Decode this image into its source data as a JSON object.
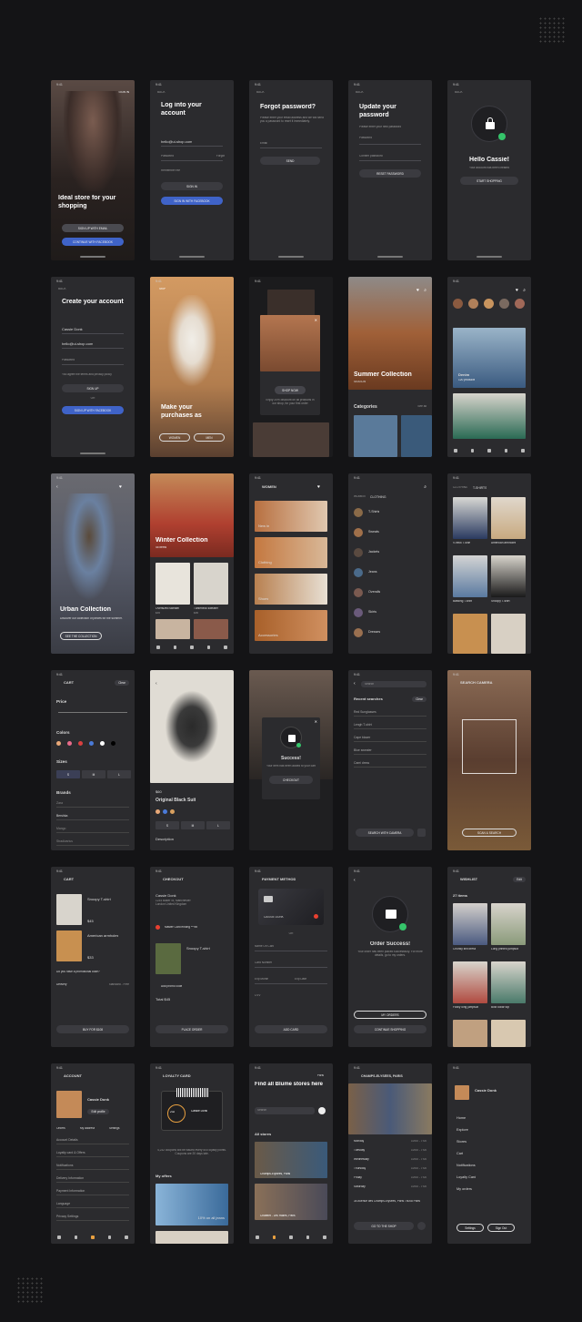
{
  "status_time": "9:41",
  "back": "BACK",
  "rows": {
    "r1": {
      "s1": {
        "signin": "SIGN IN",
        "title": "Ideal store for your shopping",
        "btn1": "SIGN UP WITH EMAIL",
        "btn2": "CONTINUE WITH FACEBOOK"
      },
      "s2": {
        "title": "Log into your account",
        "email": "hello@ui-shop.com",
        "password": "Password",
        "forgot": "Forgot",
        "remember": "Remember me",
        "btn1": "SIGN IN",
        "btn2": "SIGN IN WITH FACEBOOK"
      },
      "s3": {
        "title": "Forgot password?",
        "desc": "Please enter your email address and we will send you a password to reset it immediately.",
        "email": "Email",
        "btn": "SEND"
      },
      "s4": {
        "title": "Update your password",
        "desc": "Please enter your new password",
        "password": "Password",
        "confirm": "Confirm password",
        "btn": "RESET PASSWORD"
      },
      "s5": {
        "title": "Hello Cassie!",
        "desc": "Your account has been created",
        "btn": "START SHOPPING"
      }
    },
    "r2": {
      "s1": {
        "title": "Create your account",
        "name": "Cassie Donk",
        "email": "hello@ui-shop.com",
        "password": "Password",
        "agree": "You agree the terms and privacy policy",
        "btn1": "SIGN UP",
        "or": "OR",
        "btn2": "SIGN UP WITH FACEBOOK"
      },
      "s2": {
        "skip": "SKIP",
        "title": "Make your purchases as",
        "b1": "WOMEN",
        "b2": "MEN"
      },
      "s3": {
        "btn": "SHOP NOW",
        "desc": "Enjoy 20% discount on all products in our shop, for your first order"
      },
      "s4": {
        "title": "Summer Collection",
        "sub": "SEASON",
        "cat": "Categories",
        "see": "See all"
      },
      "s5": {
        "name": "Denim",
        "sub": "120 products"
      }
    },
    "r3": {
      "s1": {
        "title": "Urban Collection",
        "desc": "Discover our collection of pieces for the summer.",
        "btn": "SEE THE COLLECTION"
      },
      "s2": {
        "title": "Winter Collection",
        "sub": "45 items",
        "p1": "Oversized sweater",
        "p2": "Turtleneck sweater",
        "p1price": "$49",
        "p2price": "$59"
      },
      "s3": {
        "menu": "WOMEN",
        "c1": "New in",
        "c2": "Clothing",
        "c3": "Shoes",
        "c4": "Accessories"
      },
      "s4": {
        "crumb1": "WOMEN",
        "crumb2": "CLOTHING",
        "items": [
          "T-Shirts",
          "Sweats",
          "Jackets",
          "Jeans",
          "Overalls",
          "Skirts",
          "Dresses"
        ]
      },
      "s5": {
        "crumb1": "CLOTHING",
        "crumb2": "T-SHIRTS",
        "p1": "V-neck T-shirt",
        "p2": "American armholes",
        "p3": "Batwing T-shirt",
        "p4": "Snoopy T-shirt"
      }
    },
    "r4": {
      "s1": {
        "title": "CART",
        "clear": "Clear",
        "price": "Price",
        "colors": "Colors",
        "sizes": "Sizes",
        "s1": "S",
        "s2": "M",
        "s3": "L",
        "brands": "Brands",
        "b1": "Zara",
        "b2": "Bershka",
        "b3": "Mango",
        "b4": "Stradivarius"
      },
      "s2": {
        "price": "$60",
        "name": "Original Black Suit",
        "s1": "S",
        "s2": "M",
        "s3": "L",
        "desc": "Description"
      },
      "s3": {
        "title": "Success!",
        "desc": "Your item has been added to your cart",
        "btn": "CHECKOUT"
      },
      "s4": {
        "search": "Search",
        "recent": "Recent searches",
        "clear": "Clear",
        "items": [
          "Red Sunglasses",
          "Lengh T-shirt",
          "Cape blazer",
          "Blue sweater",
          "Cami dress"
        ],
        "btn": "SEARCH WITH CAMERA"
      },
      "s5": {
        "title": "SEARCH CAMERA",
        "btn": "SCAN & SEARCH"
      }
    },
    "r5": {
      "s1": {
        "title": "CART",
        "p1": "Snoopy T-shirt",
        "p1price": "$45",
        "p2": "American armholes",
        "p2price": "$33",
        "promo": "Do you have a promotional code?",
        "delivery": "Delivery",
        "delivery_val": "Standard - Free",
        "btn": "BUY FOR $108"
      },
      "s2": {
        "title": "CHECKOUT",
        "name": "Cassie Donk",
        "addr": "1234 Baker St, Manchester London United Kingdom",
        "card": "Master Card ending ***89",
        "item": "Snoopy T-shirt",
        "promo": "Add promo code",
        "total": "Total $45",
        "btn": "PLACE ORDER"
      },
      "s3": {
        "title": "PAYMENT METHOD",
        "holder": "CASSIE DONK",
        "or": "OR",
        "f1": "Name On Card",
        "f2": "Card Number",
        "f3": "Exp Month",
        "f4": "Exp Date",
        "f5": "CVV",
        "btn": "ADD CARD"
      },
      "s4": {
        "title": "Order Success!",
        "desc": "Your order has been placed successfully. For more details, go to my orders.",
        "btn1": "MY ORDERS",
        "btn2": "CONTINUE SHOPPING"
      },
      "s5": {
        "title": "WISHLIST",
        "edit": "Edit",
        "count": "27 items",
        "p1": "Chunky knit dress",
        "p2": "Long printed jumpsuit",
        "p3": "Flowy long jumpsuit",
        "p4": "Bow collar top"
      }
    },
    "r6": {
      "s1": {
        "title": "ACCOUNT",
        "name": "Cassie Donk",
        "edit": "Edit profile",
        "t1": "Orders",
        "t2": "My address",
        "t3": "Settings",
        "items": [
          "Account Details",
          "Loyalty card & Offers",
          "Notifications",
          "Delivery Information",
          "Payment Information",
          "Language",
          "Privacy Settings"
        ]
      },
      "s2": {
        "title": "LOYALTY CARD",
        "points": "232",
        "name": "Cassie Donk",
        "desc": "4,232 coupons will be issued every 500 loyalty points. Coupons are 20 days late.",
        "offers": "My offers",
        "offer1": "10% on all jeans"
      },
      "s3": {
        "title": "Find all Blume stores here",
        "city": "Paris",
        "search": "Search",
        "all": "All stores",
        "st1": "Champs-Elysées, Paris",
        "st2": "Châtelet - Les Halles, Paris"
      },
      "s4": {
        "title": "CHAMPS-ELYSÉES, PARIS",
        "days": [
          "Monday",
          "Tuesday",
          "Wednesday",
          "Thursday",
          "Friday",
          "Saturday"
        ],
        "hours": [
          "10:00 - 7:00",
          "10:00 - 7:00",
          "10:00 - 7:00",
          "10:00 - 7:00",
          "10:00 - 7:00",
          "10:00 - 7:00"
        ],
        "addr": "34 Avenue des Champs-Élysées, Paris 75008 Paris",
        "btn": "GO TO THE SHOP"
      },
      "s5": {
        "name": "Cassie Donk",
        "menu": [
          "Home",
          "Explore",
          "Stores",
          "Cart",
          "Notifications",
          "Loyalty Card",
          "My orders"
        ],
        "b1": "Settings",
        "b2": "Sign Out"
      }
    }
  },
  "colors": {
    "bg": "#141416",
    "screen": "#2b2b2e",
    "accent": "#3f63c8",
    "success": "#35c46a",
    "warm": "#c48a58"
  }
}
